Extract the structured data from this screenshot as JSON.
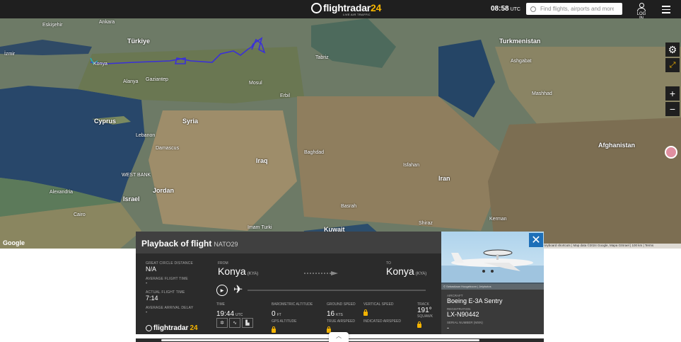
{
  "header": {
    "brand": "flightradar",
    "brand_num": "24",
    "brand_sub": "LIVE AIR TRAFFIC",
    "time": "08:58",
    "time_zone": "UTC",
    "search_placeholder": "Find flights, airports and more",
    "login_label": "LOG IN"
  },
  "map": {
    "labels": {
      "eskisehir": "Eskişehir",
      "ankara": "Ankara",
      "turkiye": "Türkiye",
      "tabriz": "Tabriz",
      "turkmenistan": "Turkmenistan",
      "ashgabat": "Ashgabat",
      "konya": "Konya",
      "alanya": "Alanya",
      "gaziantep": "Gaziantep",
      "mosul": "Mosul",
      "erbil": "Erbil",
      "mashhad": "Mashhad",
      "cyprus": "Cyprus",
      "syria": "Syria",
      "lebanon": "Lebanon",
      "damascus": "Damascus",
      "baghdad": "Baghdad",
      "iraq": "Iraq",
      "isfahan": "Isfahan",
      "afghanistan": "Afghanistan",
      "iran": "Iran",
      "westbank": "WEST BANK",
      "israel": "Israel",
      "jordan": "Jordan",
      "alexandria": "Alexandria",
      "cairo": "Cairo",
      "basrah": "Basrah",
      "kuwait": "Kuwait",
      "shiraz": "Shiraz",
      "kerman": "Kerman",
      "imamturki": "Imam Turki",
      "izmir": "İzmir"
    },
    "google": "Google",
    "attribution": "Keyboard shortcuts | Map data ©2024 Google, Mapa GISrael | 100 km | Terms"
  },
  "playback": {
    "title": "Playback of flight",
    "flight": "NATO29",
    "stats": [
      {
        "label": "GREAT CIRCLE DISTANCE",
        "value": "N/A"
      },
      {
        "label": "AVERAGE FLIGHT TIME",
        "value": "-"
      },
      {
        "label": "ACTUAL FLIGHT TIME",
        "value": "7:14"
      },
      {
        "label": "AVERAGE ARRIVAL DELAY",
        "value": "-"
      }
    ],
    "from_label": "FROM",
    "from_city": "Konya",
    "from_code": "(KYA)",
    "to_label": "TO",
    "to_city": "Konya",
    "to_code": "(KYA)",
    "time_label": "TIME",
    "time_value": "19:44",
    "time_unit": "UTC",
    "baro_label": "BAROMETRIC ALTITUDE",
    "baro_value": "0",
    "baro_unit": "FT",
    "gps_label": "GPS ALTITUDE",
    "ground_label": "GROUND SPEED",
    "ground_value": "16",
    "ground_unit": "KTS",
    "tas_label": "TRUE AIRSPEED",
    "vs_label": "VERTICAL SPEED",
    "ias_label": "INDICATED AIRSPEED",
    "track_label": "TRACK",
    "track_value": "191°",
    "squawk_label": "SQUAWK",
    "logo": "flightradar",
    "logo_num": "24"
  },
  "aircraft": {
    "photo_credit": "© Sebastiaan Hoogeboom | Jetphotos",
    "type_label": "AIRCRAFT",
    "type_value": "Boeing E-3A Sentry",
    "reg_label": "REGISTRATION",
    "reg_value": "LX-N90442",
    "serial_label": "SERIAL NUMBER (MSN)",
    "serial_value": "-"
  }
}
